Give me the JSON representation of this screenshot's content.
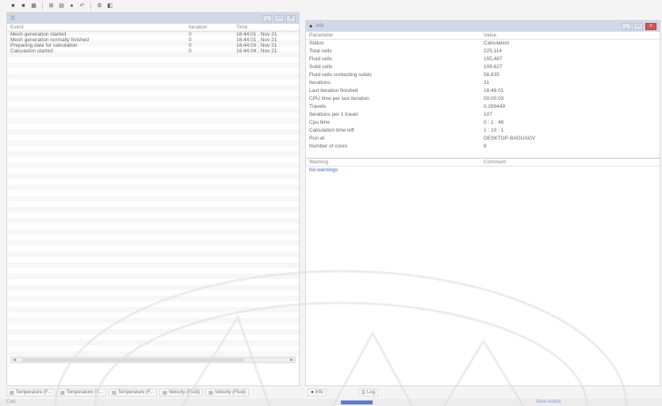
{
  "toolbar": {
    "icons": [
      "save-icon",
      "stop-icon",
      "grid-icon",
      "mesh-icon",
      "help-icon",
      "chart-icon",
      "undo-icon",
      "settings-icon",
      "info-icon"
    ]
  },
  "left_panel": {
    "columns": [
      "Event",
      "Iteration",
      "Time"
    ],
    "rows": [
      {
        "event": "Mesh generation started",
        "iteration": "0",
        "time": "16:44:01 , Nov 21"
      },
      {
        "event": "Mesh generation normally finished",
        "iteration": "0",
        "time": "16:44:01 , Nov 21"
      },
      {
        "event": "Preparing data for calculation",
        "iteration": "0",
        "time": "16:44:03 , Nov 21"
      },
      {
        "event": "Calculation started",
        "iteration": "0",
        "time": "16:44:04 , Nov 21"
      }
    ]
  },
  "right_panel": {
    "title": "Info",
    "columns": [
      "Parameter",
      "Value"
    ],
    "rows": [
      {
        "param": "Status",
        "value": "Calculation"
      },
      {
        "param": "Total cells",
        "value": "225,114"
      },
      {
        "param": "Fluid cells",
        "value": "155,487"
      },
      {
        "param": "Solid cells",
        "value": "109,627"
      },
      {
        "param": "Fluid cells contacting solids",
        "value": "56,835"
      },
      {
        "param": "Iterations",
        "value": "31"
      },
      {
        "param": "Last iteration finished",
        "value": "16:46:01"
      },
      {
        "param": "CPU time per last iteration",
        "value": "00:00:03"
      },
      {
        "param": "Travels",
        "value": "0.289449"
      },
      {
        "param": "Iterations per 1 travel",
        "value": "107"
      },
      {
        "param": "Cpu time",
        "value": "0 : 1 : 48"
      },
      {
        "param": "Calculation time left",
        "value": "1 : 10 : 1"
      },
      {
        "param": "Run at",
        "value": "DESKTOP-BAGUAGV"
      },
      {
        "param": "Number of cores",
        "value": "8"
      }
    ],
    "warnings_columns": [
      "Warning",
      "Comment"
    ],
    "warnings": [
      "No warnings"
    ]
  },
  "bottom_tabs": [
    {
      "label": "Temperature (F..."
    },
    {
      "label": "Temperature (S..."
    },
    {
      "label": "Temperature (F..."
    },
    {
      "label": "Velocity (Fluid)"
    },
    {
      "label": "Velocity (Fluid)"
    }
  ],
  "right_tabs": [
    {
      "label": "Info"
    },
    {
      "label": "Log"
    }
  ],
  "statusbar": {
    "left": "Calc",
    "link": "View Action"
  }
}
